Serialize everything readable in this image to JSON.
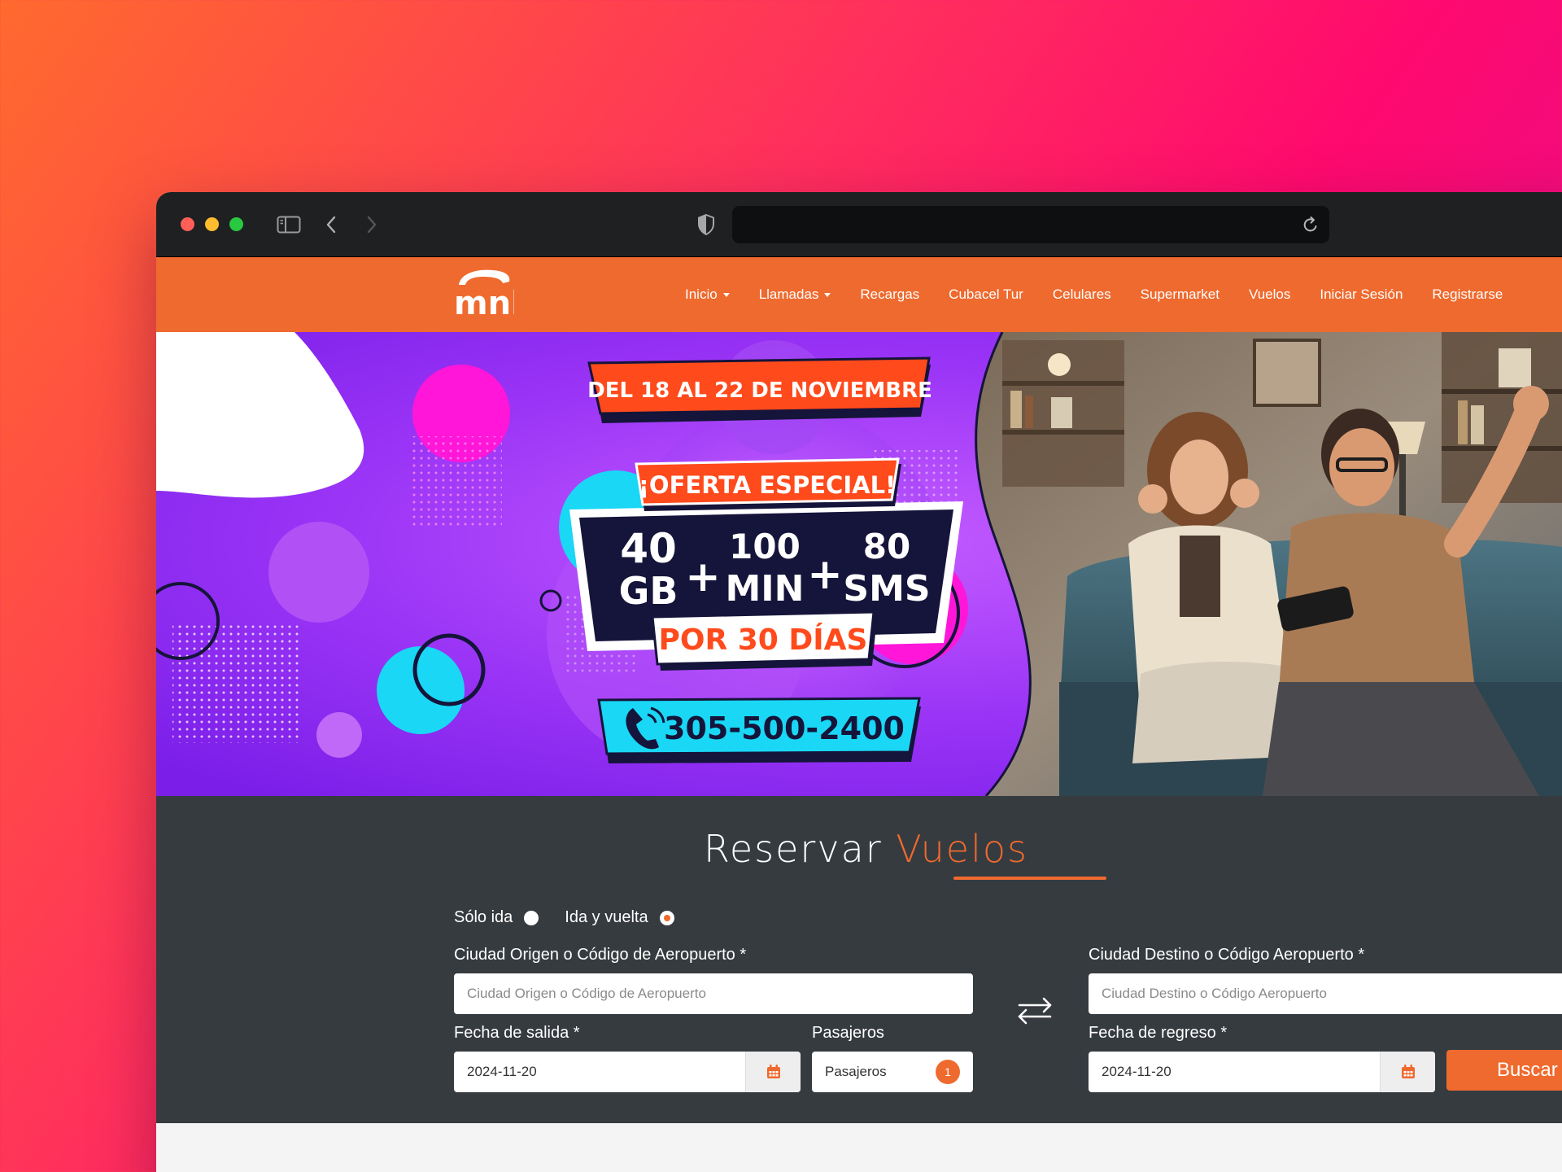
{
  "browser": {
    "traffic_lights": [
      "close",
      "minimize",
      "zoom"
    ],
    "icons": [
      "sidebar-icon",
      "back-icon",
      "forward-icon",
      "shield-icon",
      "reload-icon"
    ]
  },
  "nav": {
    "logo_text": "mnl",
    "items": [
      {
        "label": "Inicio",
        "dropdown": true
      },
      {
        "label": "Llamadas",
        "dropdown": true
      },
      {
        "label": "Recargas",
        "dropdown": false
      },
      {
        "label": "Cubacel Tur",
        "dropdown": false
      },
      {
        "label": "Celulares",
        "dropdown": false
      },
      {
        "label": "Supermarket",
        "dropdown": false
      },
      {
        "label": "Vuelos",
        "dropdown": false
      },
      {
        "label": "Iniciar Sesión",
        "dropdown": false
      },
      {
        "label": "Registrarse",
        "dropdown": false
      }
    ]
  },
  "banner": {
    "dates": "DEL 18 AL 22 DE NOVIEMBRE",
    "offer": "¡OFERTA ESPECIAL!",
    "gb_num": "40",
    "gb_unit": "GB",
    "min_num": "100",
    "min_unit": "MIN",
    "sms_num": "80",
    "sms_unit": "SMS",
    "plus": "+",
    "duration": "POR 30 DÍAS",
    "phone": "305-500-2400",
    "colors": {
      "orange": "#ff4a1c",
      "purple": "#8c2cf0",
      "navy": "#15143a",
      "cyan": "#19d7f5",
      "magenta": "#ff16d8"
    }
  },
  "booking": {
    "title_main": "Reservar",
    "title_accent": "Vuelos",
    "trip_one_way": "Sólo ida",
    "trip_round": "Ida y vuelta",
    "selected_trip": "Ida y vuelta",
    "origin_label": "Ciudad Origen o Código de Aeropuerto *",
    "origin_placeholder": "Ciudad Origen o Código de Aeropuerto",
    "dest_label": "Ciudad Destino o Código Aeropuerto *",
    "dest_placeholder": "Ciudad Destino o Código Aeropuerto",
    "departure_label": "Fecha de salida *",
    "departure_value": "2024-11-20",
    "passengers_label": "Pasajeros",
    "passengers_value": "Pasajeros",
    "passengers_count": "1",
    "return_label": "Fecha de regreso *",
    "return_value": "2024-11-20",
    "search_label": "Buscar",
    "accent_color": "#ef6a2e"
  }
}
